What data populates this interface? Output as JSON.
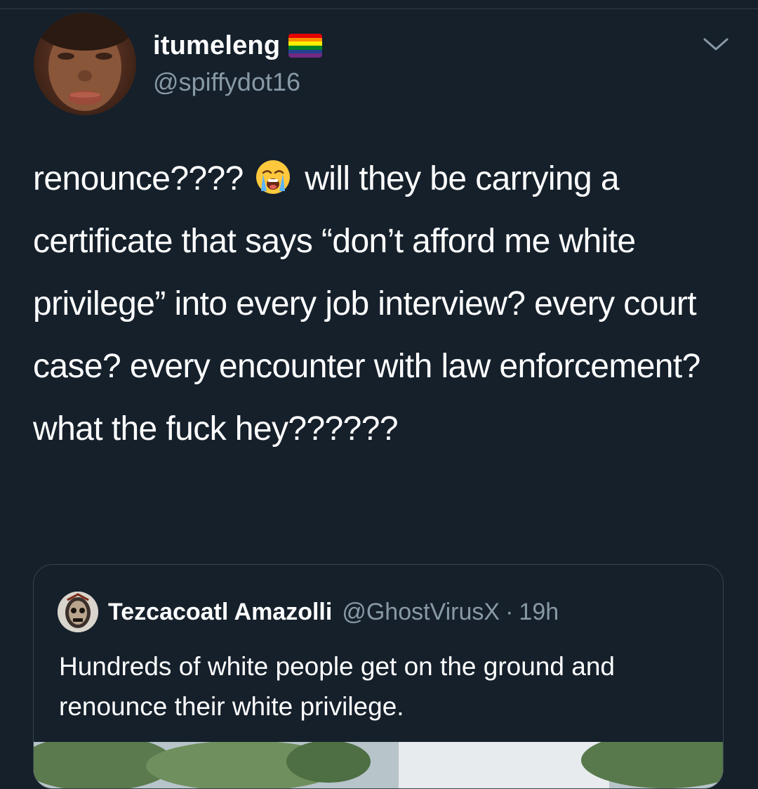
{
  "colors": {
    "background": "#15202b",
    "text_primary": "#ffffff",
    "text_secondary": "#8899a6",
    "border": "#38444d"
  },
  "tweet": {
    "author": {
      "display_name": "itumeleng",
      "name_badge_icon": "rainbow-flag-icon",
      "handle": "@spiffydot16",
      "avatar_icon": "profile-photo"
    },
    "menu_icon": "chevron-down-icon",
    "text_before_emoji": "renounce???? ",
    "emoji_icon": "loudly-crying-face-emoji",
    "text_after_emoji": " will they be carrying a certificate that says “don’t afford me white privilege” into every job interview? every court case? every encounter with law enforcement? what the fuck hey??????"
  },
  "quoted_tweet": {
    "author": {
      "display_name": "Tezcacoatl Amazolli",
      "handle": "@GhostVirusX",
      "separator": "·",
      "time": "19h",
      "avatar_icon": "skull-mask-avatar"
    },
    "text": "Hundreds of white people get on the ground and renounce their white privilege.",
    "media_icon": "outdoor-photo-thumbnail"
  }
}
